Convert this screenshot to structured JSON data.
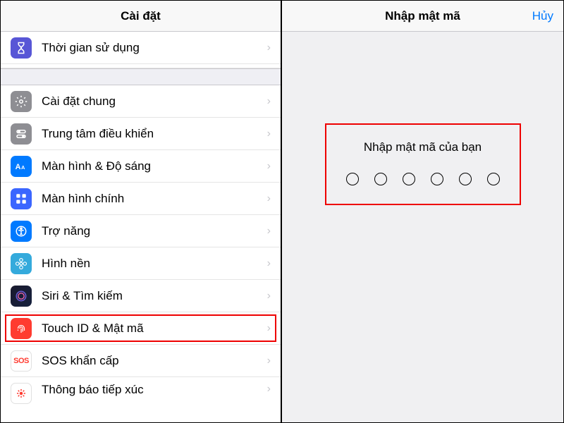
{
  "left": {
    "title": "Cài đặt",
    "items": [
      {
        "label": "Thời gian sử dụng"
      },
      {
        "label": "Cài đặt chung"
      },
      {
        "label": "Trung tâm điều khiển"
      },
      {
        "label": "Màn hình & Độ sáng"
      },
      {
        "label": "Màn hình chính"
      },
      {
        "label": "Trợ năng"
      },
      {
        "label": "Hình nền"
      },
      {
        "label": "Siri & Tìm kiếm"
      },
      {
        "label": "Touch ID & Mật mã"
      },
      {
        "label": "SOS khẩn cấp"
      },
      {
        "label": "Thông báo tiếp xúc"
      }
    ]
  },
  "right": {
    "title": "Nhập mật mã",
    "cancel": "Hủy",
    "prompt": "Nhập mật mã của bạn",
    "digits": 6
  }
}
